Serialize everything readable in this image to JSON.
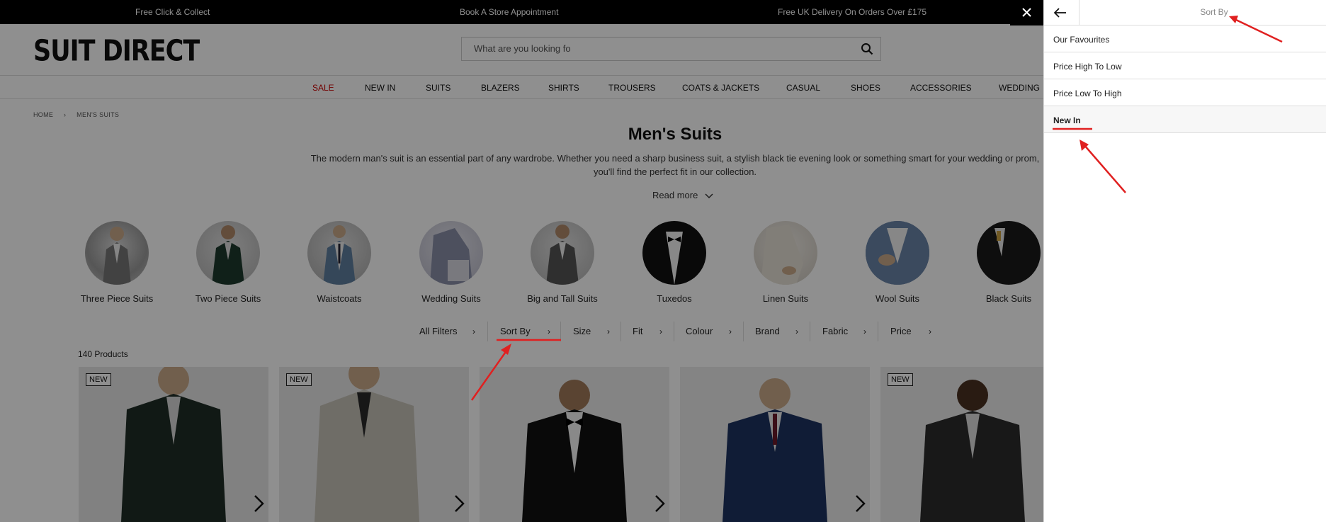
{
  "promo": {
    "items": [
      "Free Click & Collect",
      "Book A Store Appointment",
      "Free UK Delivery On Orders Over £175"
    ]
  },
  "header": {
    "logo": "SUIT DIRECT",
    "search_placeholder": "What are you looking fo"
  },
  "nav": [
    "SALE",
    "NEW IN",
    "SUITS",
    "BLAZERS",
    "SHIRTS",
    "TROUSERS",
    "COATS & JACKETS",
    "CASUAL",
    "SHOES",
    "ACCESSORIES",
    "WEDDING"
  ],
  "breadcrumb": [
    "HOME",
    "›",
    "MEN'S SUITS"
  ],
  "page": {
    "title": "Men's Suits",
    "description": "The modern man's suit is an essential part of any wardrobe. Whether you need a sharp business suit, a stylish black tie evening look or something smart for your wedding or prom, you'll find the perfect fit in our collection.",
    "read_more": "Read more"
  },
  "categories": [
    "Three Piece Suits",
    "Two Piece Suits",
    "Waistcoats",
    "Wedding Suits",
    "Big and Tall Suits",
    "Tuxedos",
    "Linen Suits",
    "Wool Suits",
    "Black Suits"
  ],
  "filters": [
    "All Filters",
    "Sort By",
    "Size",
    "Fit",
    "Colour",
    "Brand",
    "Fabric",
    "Price"
  ],
  "product_count": "140 Products",
  "products": [
    {
      "badge": "NEW"
    },
    {
      "badge": "NEW"
    },
    {
      "badge": ""
    },
    {
      "badge": ""
    },
    {
      "badge": "NEW"
    }
  ],
  "panel": {
    "title": "Sort By",
    "options": [
      "Our Favourites",
      "Price High To Low",
      "Price Low To High",
      "New In"
    ],
    "selected": "New In"
  },
  "colors": {
    "annotation_red": "#e02020",
    "sale_red": "#cc0000",
    "overlay": "rgba(0,0,0,0.44)"
  }
}
